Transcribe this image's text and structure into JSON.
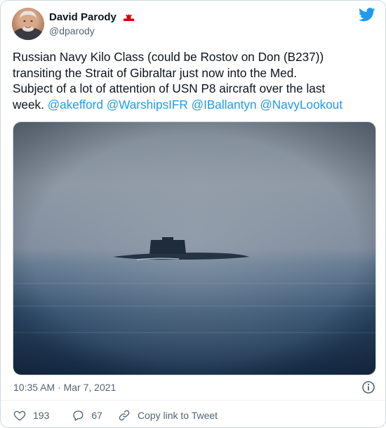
{
  "author": {
    "name": "David Parody",
    "handle": "@dparody",
    "badge_icon": "gibraltar-flag-icon"
  },
  "brand_icon": "twitter-bird-icon",
  "brand_color": "#1d9bf0",
  "tweet": {
    "lines": [
      [
        {
          "text": "Russian Navy Kilo Class (could be Rostov on Don (B237))",
          "mention": false
        }
      ],
      [
        {
          "text": "transiting the Strait of Gibraltar just now into the Med.",
          "mention": false
        }
      ],
      [
        {
          "text": "Subject of a lot of attention of USN P8 aircraft over the last",
          "mention": false
        }
      ],
      [
        {
          "text": "week. ",
          "mention": false
        },
        {
          "text": "@akefford",
          "mention": true
        },
        {
          "text": " ",
          "mention": false
        },
        {
          "text": "@WarshipsIFR",
          "mention": true
        },
        {
          "text": " ",
          "mention": false
        },
        {
          "text": "@IBallantyn",
          "mention": true
        },
        {
          "text": " ",
          "mention": false
        },
        {
          "text": "@NavyLookout",
          "mention": true
        }
      ]
    ]
  },
  "media": {
    "description_icon": "submarine-photo"
  },
  "meta": {
    "timestamp": "10:35 AM · Mar 7, 2021",
    "info_icon": "info-icon"
  },
  "actions": {
    "likes": "193",
    "replies": "67",
    "copy_link_label": "Copy link to Tweet"
  }
}
